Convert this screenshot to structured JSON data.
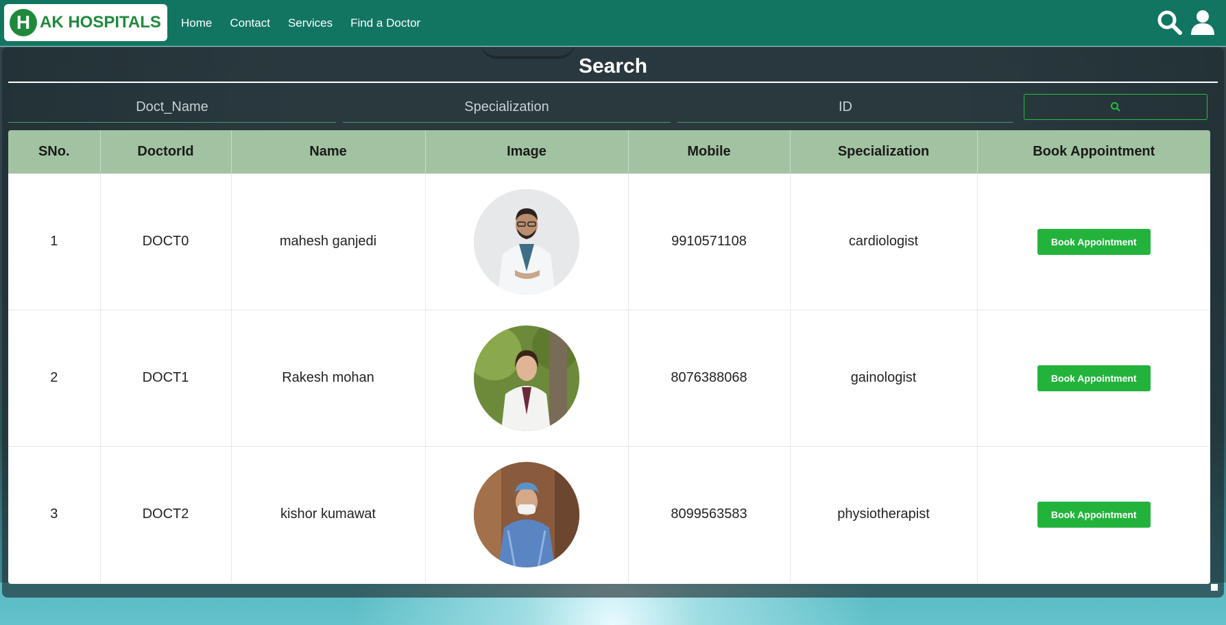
{
  "brand": {
    "logo_letter": "H",
    "name": "AK HOSPITALS",
    "color": "#1f8a3c"
  },
  "nav": {
    "links": [
      "Home",
      "Contact",
      "Services",
      "Find a Doctor"
    ],
    "icons": [
      "search-icon",
      "user-icon"
    ],
    "background": "#127562"
  },
  "search": {
    "title": "Search",
    "name_placeholder": "Doct_Name",
    "specialization_placeholder": "Specialization",
    "id_placeholder": "ID",
    "button_icon": "search-icon"
  },
  "table": {
    "headers": [
      "SNo.",
      "DoctorId",
      "Name",
      "Image",
      "Mobile",
      "Specialization",
      "Book Appointment"
    ],
    "rows": [
      {
        "sno": "1",
        "doctor_id": "DOCT0",
        "name": "mahesh ganjedi",
        "mobile": "9910571108",
        "specialization": "cardiologist",
        "action": "Book Appointment"
      },
      {
        "sno": "2",
        "doctor_id": "DOCT1",
        "name": "Rakesh mohan",
        "mobile": "8076388068",
        "specialization": "gainologist",
        "action": "Book Appointment"
      },
      {
        "sno": "3",
        "doctor_id": "DOCT2",
        "name": "kishor kumawat",
        "mobile": "8099563583",
        "specialization": "physiotherapist",
        "action": "Book Appointment"
      }
    ],
    "header_color": "#a2c3a2",
    "button_color": "#23b33d"
  }
}
